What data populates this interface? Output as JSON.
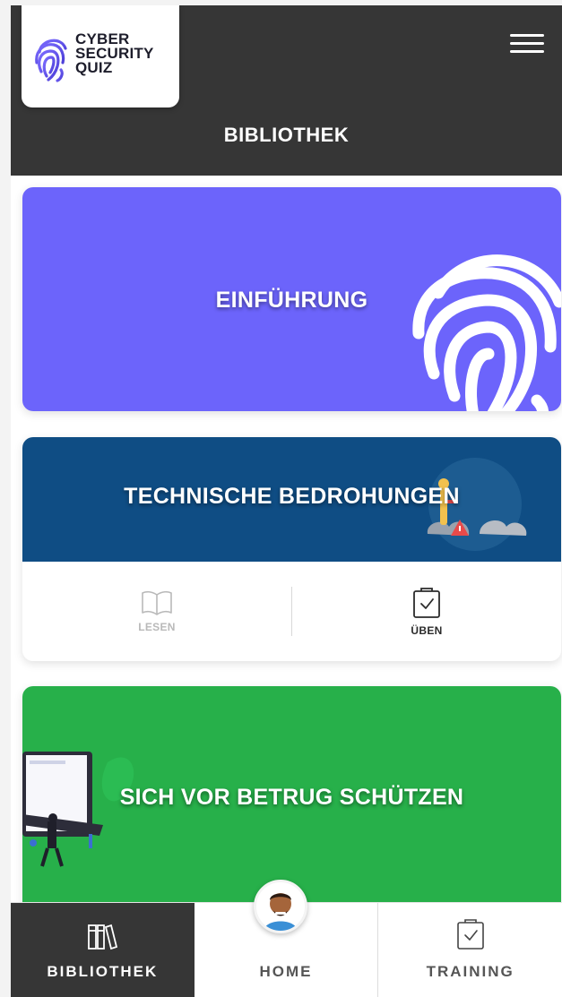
{
  "app": {
    "logo_lines": [
      "CYBER",
      "SECURITY",
      "QUIZ"
    ],
    "page_title": "BIBLIOTHEK"
  },
  "cards": [
    {
      "title": "EINFÜHRUNG",
      "color": "#6c64fb"
    },
    {
      "title": "TECHNISCHE BEDROHUNGEN",
      "color": "#0f4d84",
      "actions": [
        {
          "label": "LESEN",
          "enabled": false
        },
        {
          "label": "ÜBEN",
          "enabled": true
        }
      ]
    },
    {
      "title": "SICH VOR BETRUG SCHÜTZEN",
      "color": "#27b04a"
    }
  ],
  "tabbar": {
    "tabs": [
      {
        "label": "BIBLIOTHEK",
        "icon": "books-icon",
        "active": true
      },
      {
        "label": "HOME",
        "icon": "avatar",
        "active": false
      },
      {
        "label": "TRAINING",
        "icon": "clipboard-check-icon",
        "active": false
      }
    ]
  },
  "colors": {
    "header": "#363636",
    "accent": "#6c64fb"
  }
}
